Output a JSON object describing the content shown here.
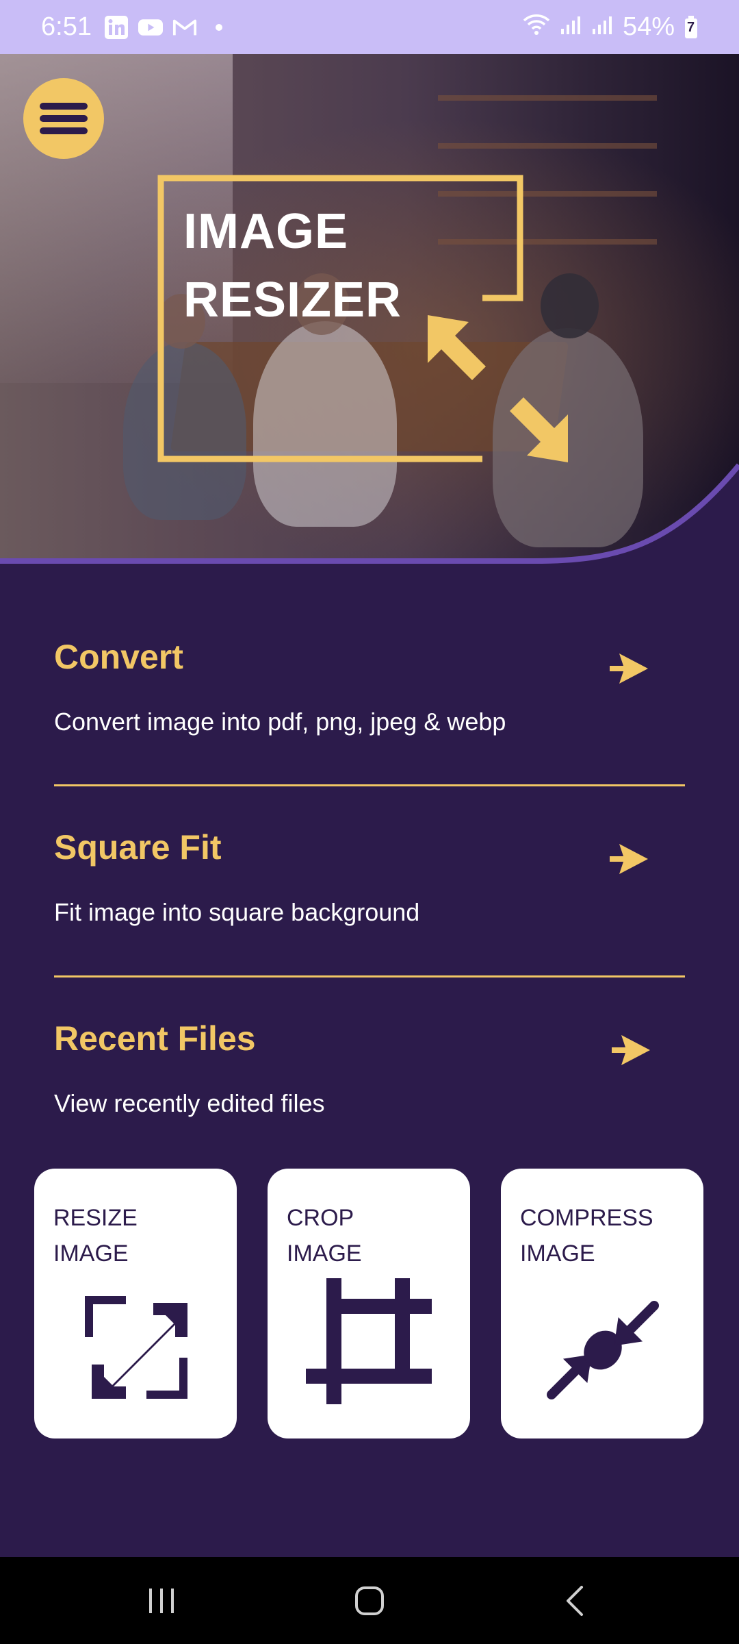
{
  "status_bar": {
    "time": "6:51",
    "notification_icons": [
      "linkedin-icon",
      "youtube-icon",
      "gmail-icon",
      "dot-icon"
    ],
    "battery": "54%",
    "battery_charging_digit": "7"
  },
  "hero": {
    "title_line1": "IMAGE",
    "title_line2": "RESIZER",
    "menu_icon": "hamburger-icon"
  },
  "menu": {
    "items": [
      {
        "title": "Convert",
        "description": "Convert image into pdf, png, jpeg & webp"
      },
      {
        "title": "Square Fit",
        "description": "Fit image into square background"
      },
      {
        "title": "Recent Files",
        "description": "View recently edited files"
      }
    ]
  },
  "cards": [
    {
      "label": "RESIZE\nIMAGE",
      "icon": "resize-icon"
    },
    {
      "label": "CROP\nIMAGE",
      "icon": "crop-icon"
    },
    {
      "label": "COMPRESS\nIMAGE",
      "icon": "compress-icon"
    }
  ],
  "colors": {
    "background": "#2c1b4b",
    "accent": "#f2c765",
    "status_bar": "#c9bdf7",
    "card": "#ffffff"
  },
  "nav_bar": {
    "buttons": [
      "recent-apps-icon",
      "home-icon",
      "back-icon"
    ]
  }
}
